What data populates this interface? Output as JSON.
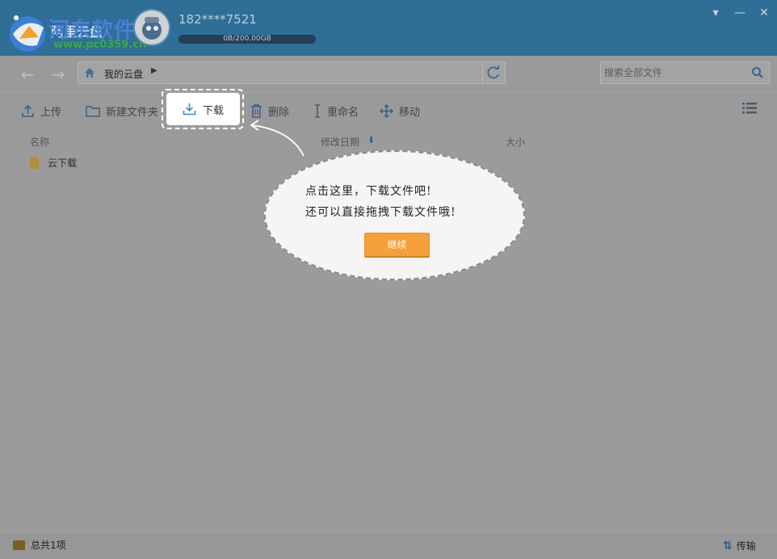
{
  "titlebar": {
    "brand": "河东软件园",
    "brand_underlay": "阿里云盘",
    "brand_url": "www.pc0359.cn",
    "username": "182****7521",
    "quota": "0B/200.00GB",
    "quota_used_fraction": 0.0
  },
  "nav": {
    "address": "我的云盘",
    "search_placeholder": "搜索全部文件"
  },
  "toolbar": {
    "upload": "上传",
    "new_folder": "新建文件夹",
    "download": "下载",
    "delete": "删除",
    "rename": "重命名",
    "move": "移动"
  },
  "columns": {
    "name": "名称",
    "modified": "修改日期",
    "size": "大小"
  },
  "files": [
    {
      "name": "云下载"
    }
  ],
  "status": {
    "total": "总共1项",
    "transfer": "传输"
  },
  "guide": {
    "line1": "点击这里，下载文件吧!",
    "line2": "还可以直接拖拽下载文件哦!",
    "continue": "继续"
  },
  "colors": {
    "titlebar": "#2f6e97",
    "accent": "#f5a03a",
    "overlay_gray": "#9b9b9b"
  }
}
